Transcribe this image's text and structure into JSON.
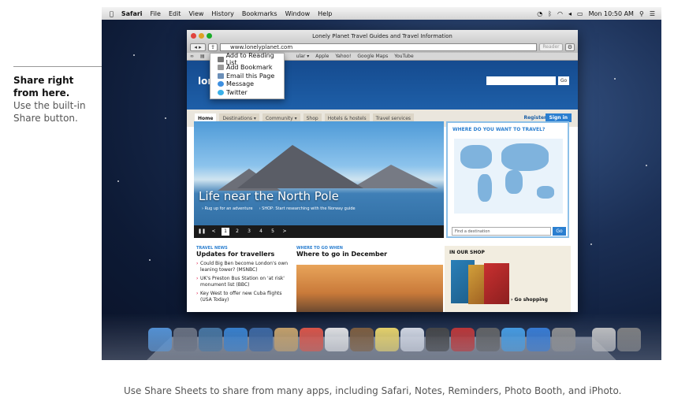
{
  "callout": {
    "title": "Share right from here.",
    "body": "Use the built-in Share button."
  },
  "caption": "Use Share Sheets to share from many apps, including Safari, Notes, Reminders, Photo Booth, and iPhoto.",
  "menubar": {
    "apple": "",
    "app": "Safari",
    "items": [
      "File",
      "Edit",
      "View",
      "History",
      "Bookmarks",
      "Window",
      "Help"
    ],
    "clock": "Mon 10:50 AM"
  },
  "window": {
    "title": "Lonely Planet Travel Guides and Travel Information",
    "url": "www.lonelyplanet.com",
    "reader": "Reader",
    "bookmarks": [
      "Apple",
      "Yahoo!",
      "Google Maps",
      "YouTube"
    ],
    "bookmark_partial": "ular ▾"
  },
  "share_menu": [
    {
      "label": "Add to Reading List",
      "icon": "reading-list-icon",
      "color": "#777777"
    },
    {
      "label": "Add Bookmark",
      "icon": "bookmark-icon",
      "color": "#999999"
    },
    {
      "label": "Email this Page",
      "icon": "mail-icon",
      "color": "#6b8fb8"
    },
    {
      "label": "Message",
      "icon": "message-icon",
      "color": "#3d8fe0"
    },
    {
      "label": "Twitter",
      "icon": "twitter-icon",
      "color": "#3ab0e8"
    }
  ],
  "site": {
    "logo": "lone",
    "search_go": "Go",
    "nav": [
      "Home",
      "Destinations ▾",
      "Community ▾",
      "Shop",
      "Hotels & hostels",
      "Travel services"
    ],
    "register": "Register",
    "signin": "Sign in",
    "hero_title": "Life near the North Pole",
    "hero_links": [
      "› Rug up for an adventure",
      "› SHOP: Start researching with the Norway guide"
    ],
    "hero_pages": [
      "❚❚",
      "<",
      "1",
      "2",
      "3",
      "4",
      "5",
      ">"
    ],
    "map_title": "WHERE DO YOU WANT TO TRAVEL?",
    "map_placeholder": "Find a destination",
    "map_go": "Go",
    "news_section": "TRAVEL NEWS",
    "news_head": "Updates for travellers",
    "news_items": [
      "Could Big Ben become London's own leaning tower? (MSNBC)",
      "UK's Preston Bus Station on 'at risk' monument list (BBC)",
      "Key West to offer new Cuba flights (USA Today)"
    ],
    "goto_section": "WHERE TO GO WHEN",
    "goto_head": "Where to go in December",
    "shop_title": "IN OUR SHOP",
    "shop_link": "› Go shopping"
  },
  "dock_colors": [
    "#4a8fd8",
    "#606878",
    "#3a6e9e",
    "#2a7bd0",
    "#2f5f9f",
    "#c9a060",
    "#e24a3a",
    "#e8e8e8",
    "#7a5530",
    "#f0d860",
    "#d8dde8",
    "#3a3a3a",
    "#c02828",
    "#5a5a5a",
    "#3a9ae8",
    "#2a76d8",
    "#8a8a8a",
    "#c0c0c0",
    "#7a7a7a"
  ]
}
